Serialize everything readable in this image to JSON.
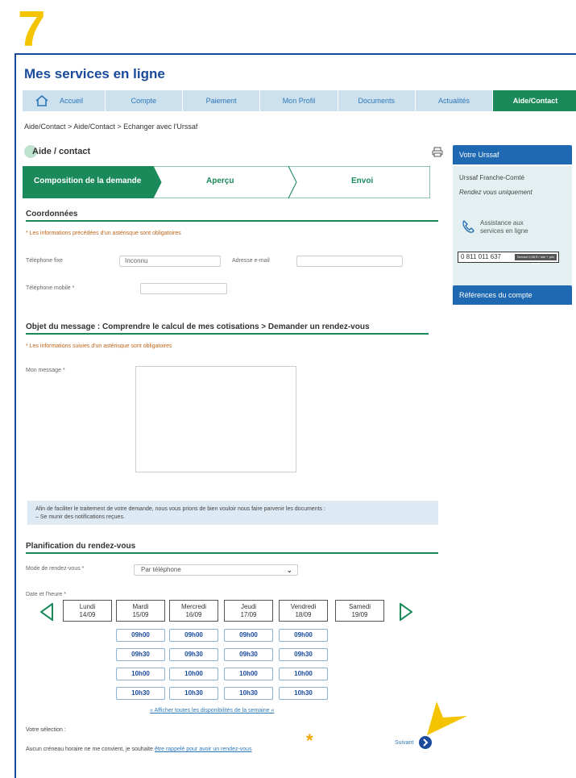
{
  "step_number": "7",
  "app_title": "Mes services en ligne",
  "nav": {
    "items": [
      "Accueil",
      "Compte",
      "Paiement",
      "Mon Profil",
      "Documents",
      "Actualités",
      "Aide/Contact"
    ],
    "active": "Aide/Contact"
  },
  "breadcrumb": "Aide/Contact > Aide/Contact > Echanger avec l'Urssaf",
  "page_title": "Aide / contact",
  "steps": [
    "Composition de la demande",
    "Aperçu",
    "Envoi"
  ],
  "coordonnees": {
    "title": "Coordonnées",
    "required_note": "* Les informations précédées d'un astérisque sont obligatoires",
    "fixed_phone_label": "Téléphone fixe",
    "fixed_phone_value": "Inconnu",
    "email_label": "Adresse e-mail",
    "mobile_label": "Téléphone mobile *"
  },
  "objet": {
    "title": "Objet du message : Comprendre le calcul de mes cotisations > Demander un rendez-vous",
    "required_note": "* Les informations suivies d'un astérisque sont obligatoires",
    "message_label": "Mon message *"
  },
  "info": {
    "line1": "Afin de faciliter le traitement de votre demande, nous vous prions de bien vouloir nous faire parvenir les documents :",
    "line2": "– Se munir des notifications reçues."
  },
  "planning": {
    "title": "Planification du rendez-vous",
    "mode_label": "Mode de rendez-vous *",
    "mode_value": "Par téléphone",
    "date_label": "Date et l'heure *",
    "days": [
      {
        "name": "Lundi",
        "date": "14/09"
      },
      {
        "name": "Mardi",
        "date": "15/09"
      },
      {
        "name": "Mercredi",
        "date": "16/09"
      },
      {
        "name": "Jeudi",
        "date": "17/09"
      },
      {
        "name": "Vendredi",
        "date": "18/09"
      },
      {
        "name": "Samedi",
        "date": "19/09"
      }
    ],
    "slots": [
      "09h00",
      "09h30",
      "10h00",
      "10h30"
    ],
    "show_all_link": "» Afficher toutes les disponibilités de la semaine «",
    "selection_label": "Votre sélection :",
    "no_slot_text": "Aucun créneau horaire ne me convient, je souhaite",
    "no_slot_link": "être rappelé pour avoir un rendez-vous",
    "next_label": "Suivant"
  },
  "sidebar": {
    "urssaf_title": "Votre Urssaf",
    "region": "Urssaf Franche-Comté",
    "note": "Rendez vous uniquement",
    "assistance_line1": "Assistance aux",
    "assistance_line2": "services en ligne",
    "phone": "0 811 011 637",
    "phone_tag": "Service 0,06 € / min + prix appel",
    "references_title": "Références du compte"
  },
  "colors": {
    "brand_blue": "#1a4a9c",
    "green": "#1a8a5a",
    "highlight": "#f5c400"
  }
}
